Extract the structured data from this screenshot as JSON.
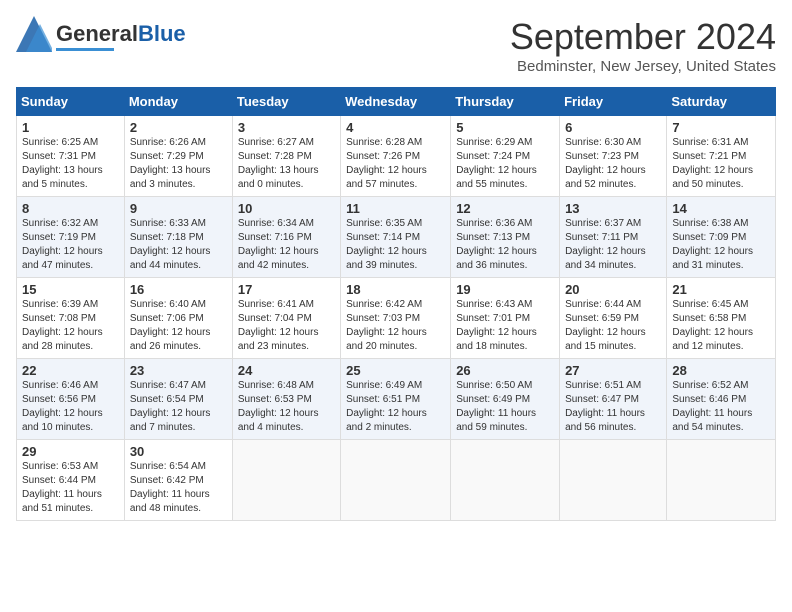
{
  "header": {
    "logo_general": "General",
    "logo_blue": "Blue",
    "month_title": "September 2024",
    "location": "Bedminster, New Jersey, United States"
  },
  "days_of_week": [
    "Sunday",
    "Monday",
    "Tuesday",
    "Wednesday",
    "Thursday",
    "Friday",
    "Saturday"
  ],
  "weeks": [
    [
      {
        "day": "1",
        "sunrise": "6:25 AM",
        "sunset": "7:31 PM",
        "daylight": "13 hours and 5 minutes."
      },
      {
        "day": "2",
        "sunrise": "6:26 AM",
        "sunset": "7:29 PM",
        "daylight": "13 hours and 3 minutes."
      },
      {
        "day": "3",
        "sunrise": "6:27 AM",
        "sunset": "7:28 PM",
        "daylight": "13 hours and 0 minutes."
      },
      {
        "day": "4",
        "sunrise": "6:28 AM",
        "sunset": "7:26 PM",
        "daylight": "12 hours and 57 minutes."
      },
      {
        "day": "5",
        "sunrise": "6:29 AM",
        "sunset": "7:24 PM",
        "daylight": "12 hours and 55 minutes."
      },
      {
        "day": "6",
        "sunrise": "6:30 AM",
        "sunset": "7:23 PM",
        "daylight": "12 hours and 52 minutes."
      },
      {
        "day": "7",
        "sunrise": "6:31 AM",
        "sunset": "7:21 PM",
        "daylight": "12 hours and 50 minutes."
      }
    ],
    [
      {
        "day": "8",
        "sunrise": "6:32 AM",
        "sunset": "7:19 PM",
        "daylight": "12 hours and 47 minutes."
      },
      {
        "day": "9",
        "sunrise": "6:33 AM",
        "sunset": "7:18 PM",
        "daylight": "12 hours and 44 minutes."
      },
      {
        "day": "10",
        "sunrise": "6:34 AM",
        "sunset": "7:16 PM",
        "daylight": "12 hours and 42 minutes."
      },
      {
        "day": "11",
        "sunrise": "6:35 AM",
        "sunset": "7:14 PM",
        "daylight": "12 hours and 39 minutes."
      },
      {
        "day": "12",
        "sunrise": "6:36 AM",
        "sunset": "7:13 PM",
        "daylight": "12 hours and 36 minutes."
      },
      {
        "day": "13",
        "sunrise": "6:37 AM",
        "sunset": "7:11 PM",
        "daylight": "12 hours and 34 minutes."
      },
      {
        "day": "14",
        "sunrise": "6:38 AM",
        "sunset": "7:09 PM",
        "daylight": "12 hours and 31 minutes."
      }
    ],
    [
      {
        "day": "15",
        "sunrise": "6:39 AM",
        "sunset": "7:08 PM",
        "daylight": "12 hours and 28 minutes."
      },
      {
        "day": "16",
        "sunrise": "6:40 AM",
        "sunset": "7:06 PM",
        "daylight": "12 hours and 26 minutes."
      },
      {
        "day": "17",
        "sunrise": "6:41 AM",
        "sunset": "7:04 PM",
        "daylight": "12 hours and 23 minutes."
      },
      {
        "day": "18",
        "sunrise": "6:42 AM",
        "sunset": "7:03 PM",
        "daylight": "12 hours and 20 minutes."
      },
      {
        "day": "19",
        "sunrise": "6:43 AM",
        "sunset": "7:01 PM",
        "daylight": "12 hours and 18 minutes."
      },
      {
        "day": "20",
        "sunrise": "6:44 AM",
        "sunset": "6:59 PM",
        "daylight": "12 hours and 15 minutes."
      },
      {
        "day": "21",
        "sunrise": "6:45 AM",
        "sunset": "6:58 PM",
        "daylight": "12 hours and 12 minutes."
      }
    ],
    [
      {
        "day": "22",
        "sunrise": "6:46 AM",
        "sunset": "6:56 PM",
        "daylight": "12 hours and 10 minutes."
      },
      {
        "day": "23",
        "sunrise": "6:47 AM",
        "sunset": "6:54 PM",
        "daylight": "12 hours and 7 minutes."
      },
      {
        "day": "24",
        "sunrise": "6:48 AM",
        "sunset": "6:53 PM",
        "daylight": "12 hours and 4 minutes."
      },
      {
        "day": "25",
        "sunrise": "6:49 AM",
        "sunset": "6:51 PM",
        "daylight": "12 hours and 2 minutes."
      },
      {
        "day": "26",
        "sunrise": "6:50 AM",
        "sunset": "6:49 PM",
        "daylight": "11 hours and 59 minutes."
      },
      {
        "day": "27",
        "sunrise": "6:51 AM",
        "sunset": "6:47 PM",
        "daylight": "11 hours and 56 minutes."
      },
      {
        "day": "28",
        "sunrise": "6:52 AM",
        "sunset": "6:46 PM",
        "daylight": "11 hours and 54 minutes."
      }
    ],
    [
      {
        "day": "29",
        "sunrise": "6:53 AM",
        "sunset": "6:44 PM",
        "daylight": "11 hours and 51 minutes."
      },
      {
        "day": "30",
        "sunrise": "6:54 AM",
        "sunset": "6:42 PM",
        "daylight": "11 hours and 48 minutes."
      },
      null,
      null,
      null,
      null,
      null
    ]
  ]
}
